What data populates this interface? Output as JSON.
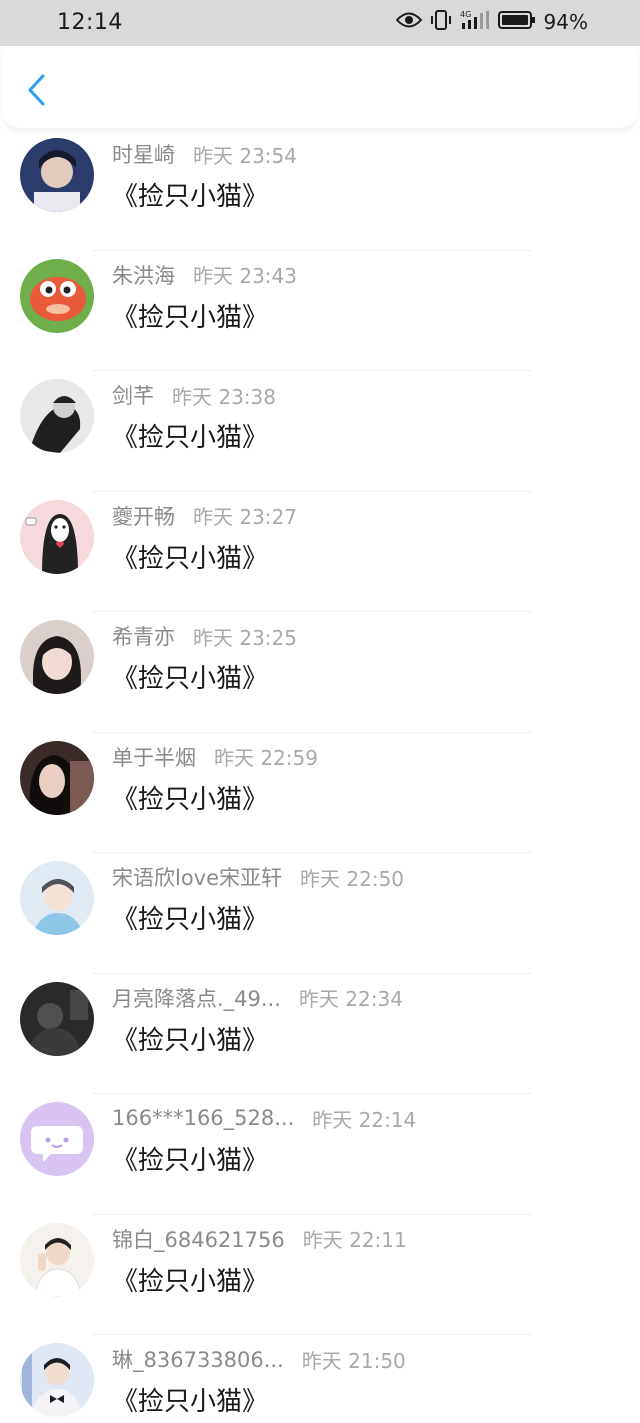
{
  "status_bar": {
    "time": "12:14",
    "network": "4G",
    "battery": "94%"
  },
  "header": {
    "back_icon": "chevron-left-icon",
    "accent_color": "#2a9df4"
  },
  "rows": [
    {
      "name": "时星崎",
      "time": "昨天 23:54",
      "message": "《捡只小猫》",
      "avatar": "photo-boy-dark"
    },
    {
      "name": "朱洪海",
      "time": "昨天 23:43",
      "message": "《捡只小猫》",
      "avatar": "cartoon-fish"
    },
    {
      "name": "剑芊",
      "time": "昨天 23:38",
      "message": "《捡只小猫》",
      "avatar": "photo-bw-boy"
    },
    {
      "name": "夔开畅",
      "time": "昨天 23:27",
      "message": "《捡只小猫》",
      "avatar": "no-face-cartoon"
    },
    {
      "name": "希青亦",
      "time": "昨天 23:25",
      "message": "《捡只小猫》",
      "avatar": "photo-girl"
    },
    {
      "name": "单于半烟",
      "time": "昨天 22:59",
      "message": "《捡只小猫》",
      "avatar": "photo-girl-dark"
    },
    {
      "name": "宋语欣love宋亚轩",
      "time": "昨天 22:50",
      "message": "《捡只小猫》",
      "avatar": "photo-boy-blue"
    },
    {
      "name": "月亮降落点._49...",
      "time": "昨天 22:34",
      "message": "《捡只小猫》",
      "avatar": "photo-dark"
    },
    {
      "name": "166***166_528...",
      "time": "昨天 22:14",
      "message": "《捡只小猫》",
      "avatar": "default-chat-icon"
    },
    {
      "name": "锦白_684621756",
      "time": "昨天 22:11",
      "message": "《捡只小猫》",
      "avatar": "photo-boy-light"
    },
    {
      "name": "琳_836733806...",
      "time": "昨天 21:50",
      "message": "《捡只小猫》",
      "avatar": "photo-boy-bow"
    }
  ]
}
